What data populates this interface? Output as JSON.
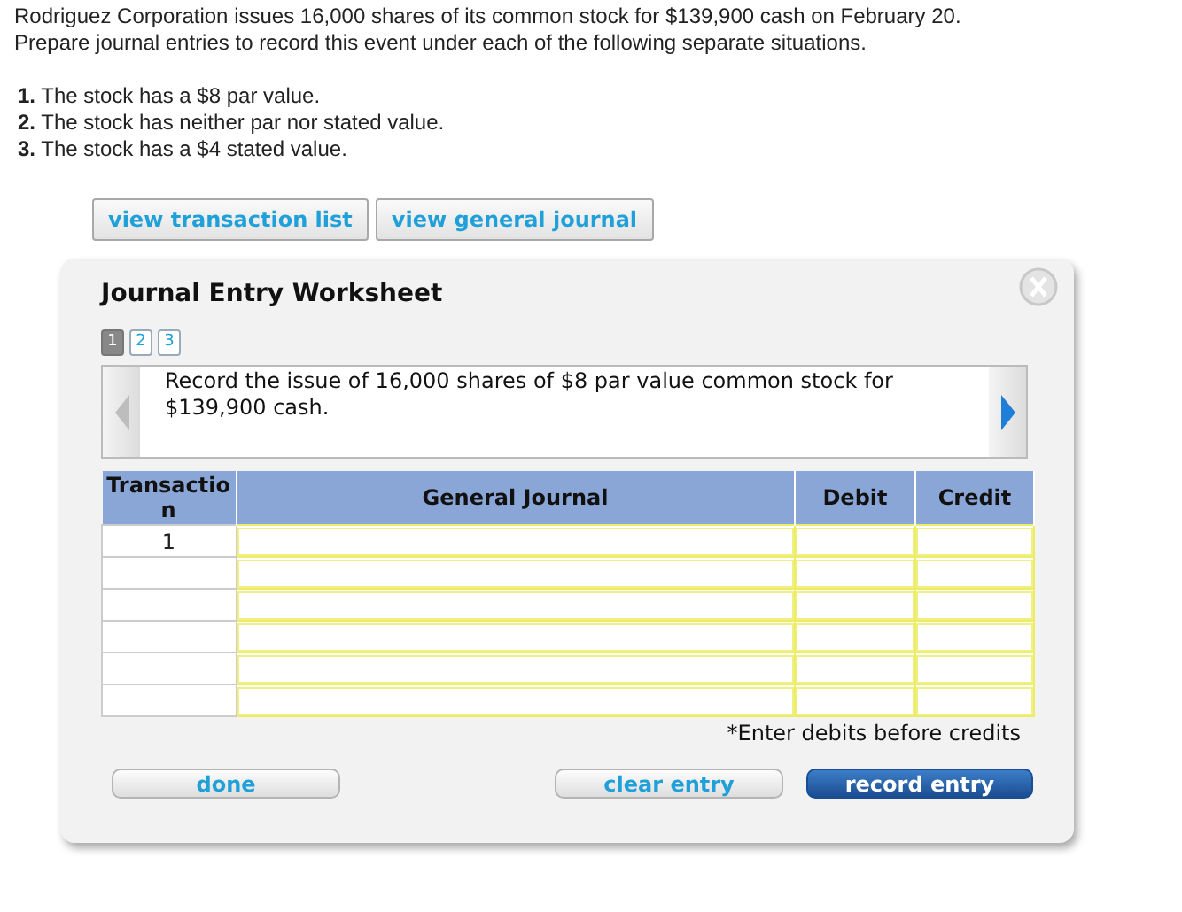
{
  "question": {
    "lines": [
      "Rodriguez Corporation issues 16,000 shares of its common stock for $139,900 cash on February 20.",
      "Prepare journal entries to record this event under each of the following separate situations."
    ],
    "situations": [
      "**1.** The stock has a $8 par value.",
      "**2.** The stock has neither par nor stated value.",
      "**3.** The stock has a $4 stated value."
    ]
  },
  "top_buttons": [
    "view transaction list",
    "view general journal"
  ],
  "worksheet": {
    "title": "Journal Entry Worksheet",
    "pages": [
      {
        "label": "1",
        "selected": true
      },
      {
        "label": "2",
        "selected": false
      },
      {
        "label": "3",
        "selected": false
      }
    ],
    "prev": {
      "disabled": true
    },
    "next": {
      "disabled": false
    },
    "description": "Record the issue of 16,000 shares of $8 par value common stock for $139,900 cash.",
    "table": {
      "columns": [
        "Transaction",
        "General Journal",
        "Debit",
        "Credit"
      ],
      "rows": [
        {
          "transaction": "1"
        },
        {},
        {},
        {},
        {},
        {}
      ]
    },
    "note": "*Enter debits before credits",
    "buttons": [
      {
        "label": "done",
        "kind": "plain"
      },
      {
        "label": "clear entry",
        "kind": "plain"
      },
      {
        "label": "record entry",
        "kind": "primary"
      }
    ]
  }
}
